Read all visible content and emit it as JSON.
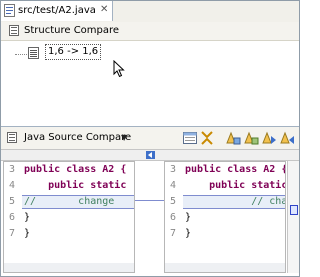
{
  "tab": {
    "title": "src/test/A2.java",
    "close_icon": "close-icon",
    "file_icon": "java-file-icon"
  },
  "structure": {
    "header": "Structure Compare",
    "header_icon": "structure-compare-icon",
    "tree_item_label": "1,6 -> 1,6",
    "tree_item_icon": "class-change-icon"
  },
  "java_compare": {
    "header": "Java Source Compare",
    "header_icon": "java-compare-icon",
    "toolbar": [
      {
        "name": "ignore-whitespace-icon"
      },
      {
        "name": "show-ancestor-icon"
      },
      {
        "name": "copy-all-left-to-right-icon"
      },
      {
        "name": "copy-current-left-to-right-icon"
      },
      {
        "name": "next-difference-icon"
      },
      {
        "name": "previous-difference-icon"
      }
    ],
    "left": {
      "lines": [
        {
          "num": "3",
          "code": "public class A2 {"
        },
        {
          "num": "4",
          "code": "    public static"
        },
        {
          "num": "5",
          "code": "//       change"
        },
        {
          "num": "6",
          "code": "}"
        },
        {
          "num": "7",
          "code": "}"
        }
      ]
    },
    "right": {
      "lines": [
        {
          "num": "3",
          "code": "public class A2 {"
        },
        {
          "num": "4",
          "code": "    public static"
        },
        {
          "num": "5",
          "code": "           // change"
        },
        {
          "num": "6",
          "code": "}"
        },
        {
          "num": "7",
          "code": "}"
        }
      ]
    },
    "colors": {
      "keyword": "#7f0055",
      "comment": "#3f7f5f",
      "change_border": "#7f8ccf",
      "change_fill": "#e8eef8"
    }
  }
}
